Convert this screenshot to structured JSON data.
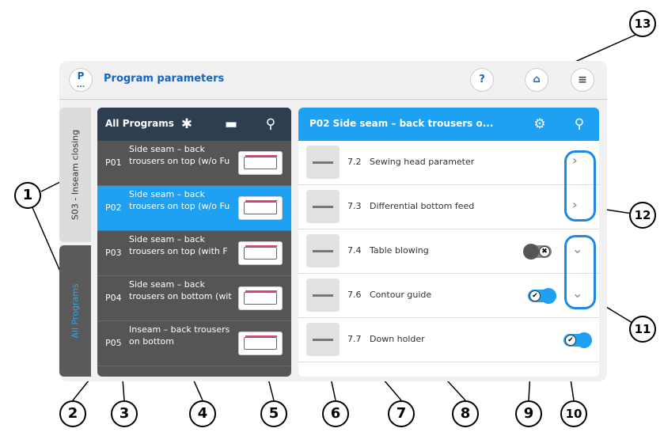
{
  "header": {
    "logo_letter": "P",
    "logo_dots": "...",
    "title": "Program parameters",
    "help_label": "?",
    "home_label": "⌂",
    "menu_label": "≡"
  },
  "tabs": [
    {
      "label": "S03 - Inseam closing"
    },
    {
      "label": "All Programs"
    }
  ],
  "programs_panel": {
    "title": "All Programs",
    "rows": [
      {
        "num": "P01",
        "name": "Side seam – back trousers on top (w/o Fu"
      },
      {
        "num": "P02",
        "name": "Side seam – back trousers on top (w/o Fu"
      },
      {
        "num": "P03",
        "name": "Side seam – back trousers on top (with F"
      },
      {
        "num": "P04",
        "name": "Side seam – back trousers on bottom (wit"
      },
      {
        "num": "P05",
        "name": "Inseam – back trousers on bottom"
      }
    ]
  },
  "params_panel": {
    "title": "P02 Side seam – back trousers o...",
    "rows": [
      {
        "num": "7.2",
        "label": "Sewing head parameter"
      },
      {
        "num": "7.3",
        "label": "Differential bottom feed"
      },
      {
        "num": "7.4",
        "label": "Table blowing"
      },
      {
        "num": "7.6",
        "label": "Contour guide"
      },
      {
        "num": "7.7",
        "label": "Down holder"
      }
    ]
  },
  "controls": {
    "chevron_right": "›",
    "chevron_down": "⌄",
    "toggle_off_mark": "✖",
    "toggle_on_mark": "✔"
  },
  "callouts": [
    "1",
    "2",
    "3",
    "4",
    "5",
    "6",
    "7",
    "8",
    "9",
    "10",
    "11",
    "12",
    "13"
  ],
  "colors": {
    "accent_blue": "#1ea1f2",
    "dark_header": "#2d3e50",
    "highlight": "#1e88e5"
  }
}
